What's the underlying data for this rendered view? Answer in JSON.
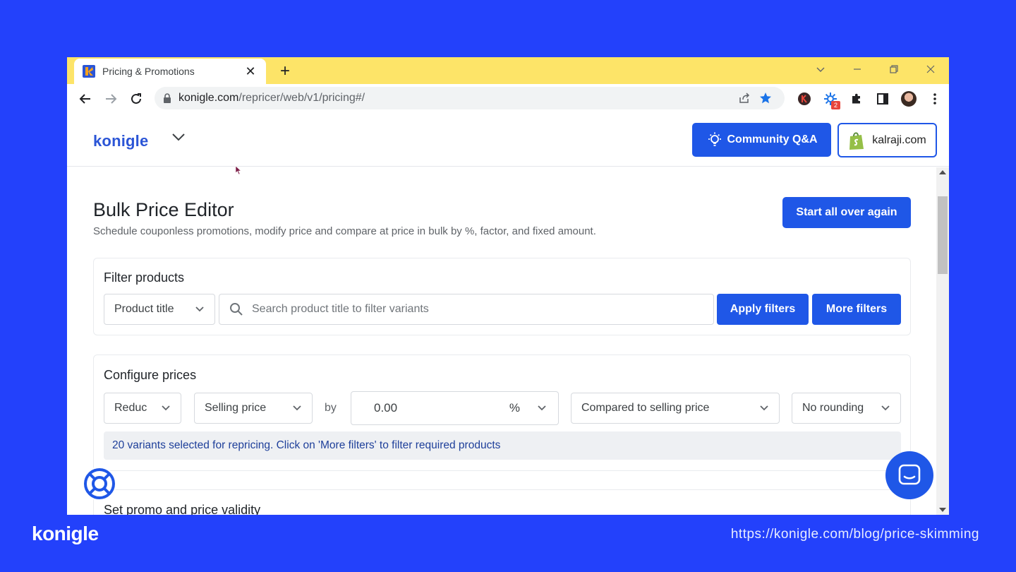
{
  "browser": {
    "tab_title": "Pricing & Promotions",
    "url_host": "konigle.com",
    "url_path": "/repricer/web/v1/pricing#/",
    "extension_badge": "2"
  },
  "header": {
    "logo": "konigle",
    "community_label": "Community Q&A",
    "store_label": "kalraji.com"
  },
  "page": {
    "title": "Bulk Price Editor",
    "subtitle": "Schedule couponless promotions, modify price and compare at price in bulk by %, factor, and fixed amount.",
    "restart_label": "Start all over again"
  },
  "filter": {
    "title": "Filter products",
    "field_select": "Product title",
    "search_placeholder": "Search product title to filter variants",
    "apply_label": "Apply filters",
    "more_label": "More filters"
  },
  "configure": {
    "title": "Configure prices",
    "action_select": "Reduc",
    "target_select": "Selling price",
    "by_label": "by",
    "amount_value": "0.00",
    "unit_select": "%",
    "compare_select": "Compared to selling price",
    "rounding_select": "No rounding",
    "info_text": "20 variants selected for repricing. Click on 'More filters' to filter required products"
  },
  "promo": {
    "title": "Set promo and price validity"
  },
  "footer": {
    "logo": "konigle",
    "url": "https://konigle.com/blog/price-skimming"
  },
  "colors": {
    "background": "#2341fb",
    "tabstrip": "#fde468",
    "primary": "#1f57e7",
    "info_text": "#1e3f9a"
  }
}
